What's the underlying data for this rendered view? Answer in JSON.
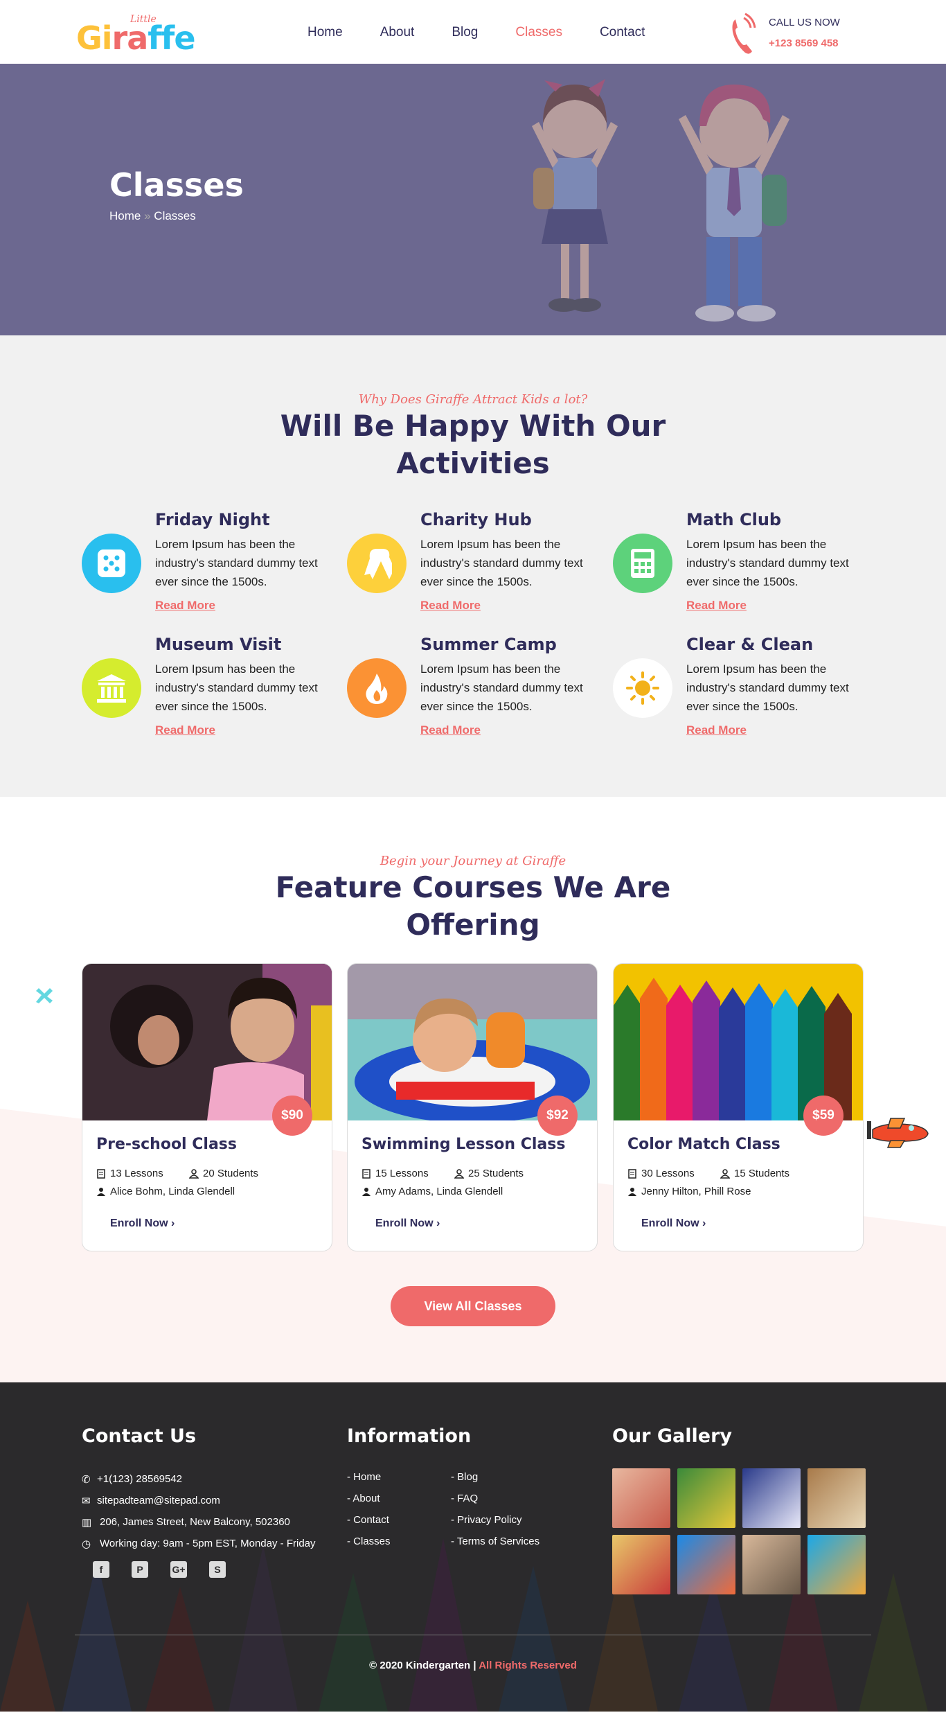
{
  "header": {
    "logo_small": "Little",
    "logo_word": "Giraffe",
    "nav": [
      {
        "label": "Home"
      },
      {
        "label": "About"
      },
      {
        "label": "Blog"
      },
      {
        "label": "Classes",
        "active": true
      },
      {
        "label": "Contact"
      }
    ],
    "call_label": "CALL US NOW",
    "call_number": "+123 8569 458"
  },
  "hero": {
    "title": "Classes",
    "crumb_home": "Home",
    "crumb_sep": "»",
    "crumb_current": "Classes"
  },
  "activities": {
    "subtitle": "Why Does Giraffe Attract Kids a lot?",
    "title_line1": "Will Be Happy With Our",
    "title_line2": "Activities",
    "items": [
      {
        "title": "Friday Night",
        "text": "Lorem Ipsum has been the industry's standard dummy text ever since the 1500s.",
        "link": "Read More",
        "icon": "dice-icon",
        "color": "#29bfee"
      },
      {
        "title": "Charity Hub",
        "text": "Lorem Ipsum has been the industry's standard dummy text ever since the 1500s.",
        "link": "Read More",
        "icon": "ribbon-icon",
        "color": "#fdd03b"
      },
      {
        "title": "Math Club",
        "text": "Lorem Ipsum has been the industry's standard dummy text ever since the 1500s.",
        "link": "Read More",
        "icon": "calculator-icon",
        "color": "#5dd27b"
      },
      {
        "title": "Museum Visit",
        "text": "Lorem Ipsum has been the industry's standard dummy text ever since the 1500s.",
        "link": "Read More",
        "icon": "museum-icon",
        "color": "#d5ec2e"
      },
      {
        "title": "Summer Camp",
        "text": "Lorem Ipsum has been the industry's standard dummy text ever since the 1500s.",
        "link": "Read More",
        "icon": "fire-icon",
        "color": "#fb9234"
      },
      {
        "title": "Clear & Clean",
        "text": "Lorem Ipsum has been the industry's standard dummy text ever since the 1500s.",
        "link": "Read More",
        "icon": "sun-icon",
        "color": "#ffffff"
      }
    ]
  },
  "courses": {
    "subtitle": "Begin your Journey at Giraffe",
    "title_line1": "Feature Courses We Are",
    "title_line2": "Offering",
    "items": [
      {
        "price": "$90",
        "title": "Pre-school Class",
        "lessons": "13 Lessons",
        "students": "20 Students",
        "teachers": "Alice Bohm, Linda Glendell",
        "enroll": "Enroll Now"
      },
      {
        "price": "$92",
        "title": "Swimming Lesson Class",
        "lessons": "15 Lessons",
        "students": "25 Students",
        "teachers": "Amy Adams, Linda Glendell",
        "enroll": "Enroll Now"
      },
      {
        "price": "$59",
        "title": "Color Match Class",
        "lessons": "30 Lessons",
        "students": "15 Students",
        "teachers": "Jenny Hilton, Phill Rose",
        "enroll": "Enroll Now"
      }
    ],
    "view_all": "View All Classes"
  },
  "footer": {
    "contact_title": "Contact Us",
    "phone": "+1(123) 28569542",
    "email": "sitepadteam@sitepad.com",
    "address": "206, James Street, New Balcony, 502360",
    "hours": "Working day: 9am - 5pm EST, Monday - Friday",
    "social": [
      {
        "icon": "facebook-icon",
        "glyph": "f"
      },
      {
        "icon": "pinterest-icon",
        "glyph": "P"
      },
      {
        "icon": "google-plus-icon",
        "glyph": "G+"
      },
      {
        "icon": "skype-icon",
        "glyph": "S"
      }
    ],
    "info_title": "Information",
    "info_col1": [
      "- Home",
      "- About",
      "- Contact",
      "- Classes"
    ],
    "info_col2": [
      "- Blog",
      "- FAQ",
      "- Privacy Policy",
      "- Terms of Services"
    ],
    "gallery_title": "Our Gallery",
    "copyright": "© 2020 Kindergarten |",
    "rights": "All Rights Reserved"
  }
}
